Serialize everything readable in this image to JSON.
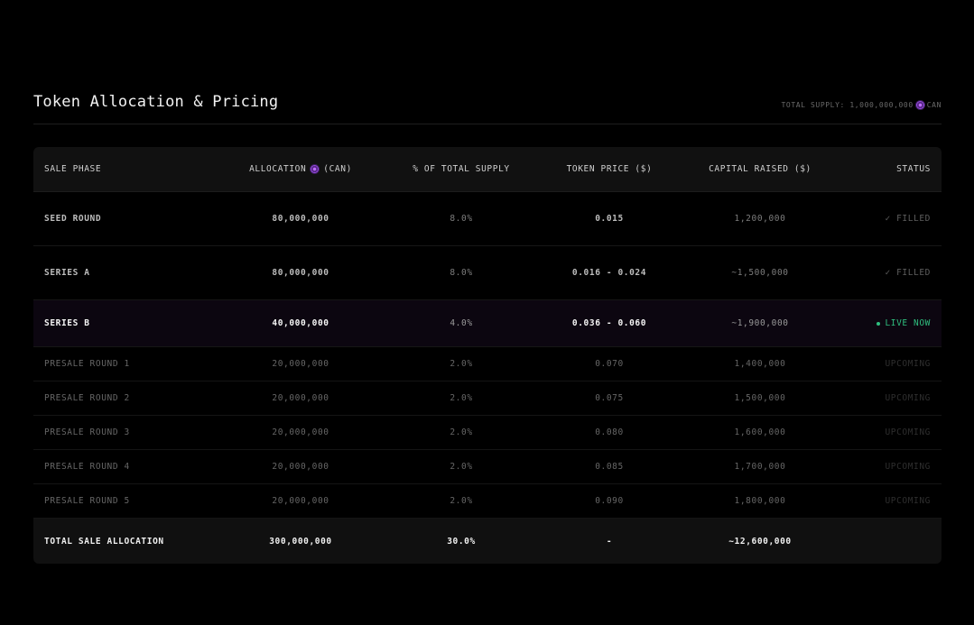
{
  "header": {
    "title": "Token Allocation & Pricing",
    "total_supply_label": "TOTAL SUPPLY: 1,000,000,000",
    "total_supply_unit": "CAN"
  },
  "table": {
    "columns": {
      "phase": "SALE PHASE",
      "allocation": "ALLOCATION",
      "allocation_unit": "(CAN)",
      "percent": "% OF TOTAL SUPPLY",
      "price": "TOKEN PRICE ($)",
      "capital": "CAPITAL RAISED ($)",
      "status": "STATUS"
    },
    "rows": [
      {
        "phase": "SEED ROUND",
        "allocation": "80,000,000",
        "percent": "8.0%",
        "price": "0.015",
        "capital": "1,200,000",
        "status": "✓ FILLED"
      },
      {
        "phase": "SERIES A",
        "allocation": "80,000,000",
        "percent": "8.0%",
        "price": "0.016 - 0.024",
        "capital": "~1,500,000",
        "status": "✓ FILLED"
      },
      {
        "phase": "SERIES B",
        "allocation": "40,000,000",
        "percent": "4.0%",
        "price": "0.036 - 0.060",
        "capital": "~1,900,000",
        "status": "LIVE NOW"
      },
      {
        "phase": "PRESALE ROUND 1",
        "allocation": "20,000,000",
        "percent": "2.0%",
        "price": "0.070",
        "capital": "1,400,000",
        "status": "UPCOMING"
      },
      {
        "phase": "PRESALE ROUND 2",
        "allocation": "20,000,000",
        "percent": "2.0%",
        "price": "0.075",
        "capital": "1,500,000",
        "status": "UPCOMING"
      },
      {
        "phase": "PRESALE ROUND 3",
        "allocation": "20,000,000",
        "percent": "2.0%",
        "price": "0.080",
        "capital": "1,600,000",
        "status": "UPCOMING"
      },
      {
        "phase": "PRESALE ROUND 4",
        "allocation": "20,000,000",
        "percent": "2.0%",
        "price": "0.085",
        "capital": "1,700,000",
        "status": "UPCOMING"
      },
      {
        "phase": "PRESALE ROUND 5",
        "allocation": "20,000,000",
        "percent": "2.0%",
        "price": "0.090",
        "capital": "1,800,000",
        "status": "UPCOMING"
      }
    ],
    "total": {
      "phase": "TOTAL SALE ALLOCATION",
      "allocation": "300,000,000",
      "percent": "30.0%",
      "price": "-",
      "capital": "~12,600,000"
    }
  },
  "colors": {
    "background": "#000000",
    "live_accent": "#2fbf7f",
    "token_accent": "#a04df0"
  },
  "icons": {
    "token": "can-token-icon",
    "live": "live-dot-icon"
  }
}
